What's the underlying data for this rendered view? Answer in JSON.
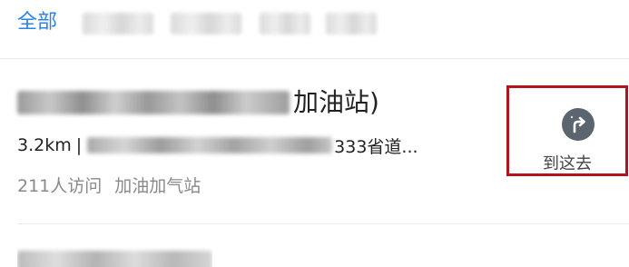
{
  "tabs": {
    "active_label": "全部",
    "other_tabs": [
      "obscured",
      "obscured",
      "obscured",
      "obscured"
    ]
  },
  "result": {
    "title_suffix": "加油站)",
    "distance": "3.2km",
    "separator": "|",
    "address_suffix": "333省道...",
    "visits": "211人访问",
    "category": "加油加气站"
  },
  "nav_button": {
    "label": "到这去",
    "icon": "turn-right-arrow-icon",
    "icon_bg": "#5b6570",
    "highlight_border": "#b3141b"
  },
  "colors": {
    "accent": "#2b83ea",
    "meta_text": "#8a8a8a"
  }
}
